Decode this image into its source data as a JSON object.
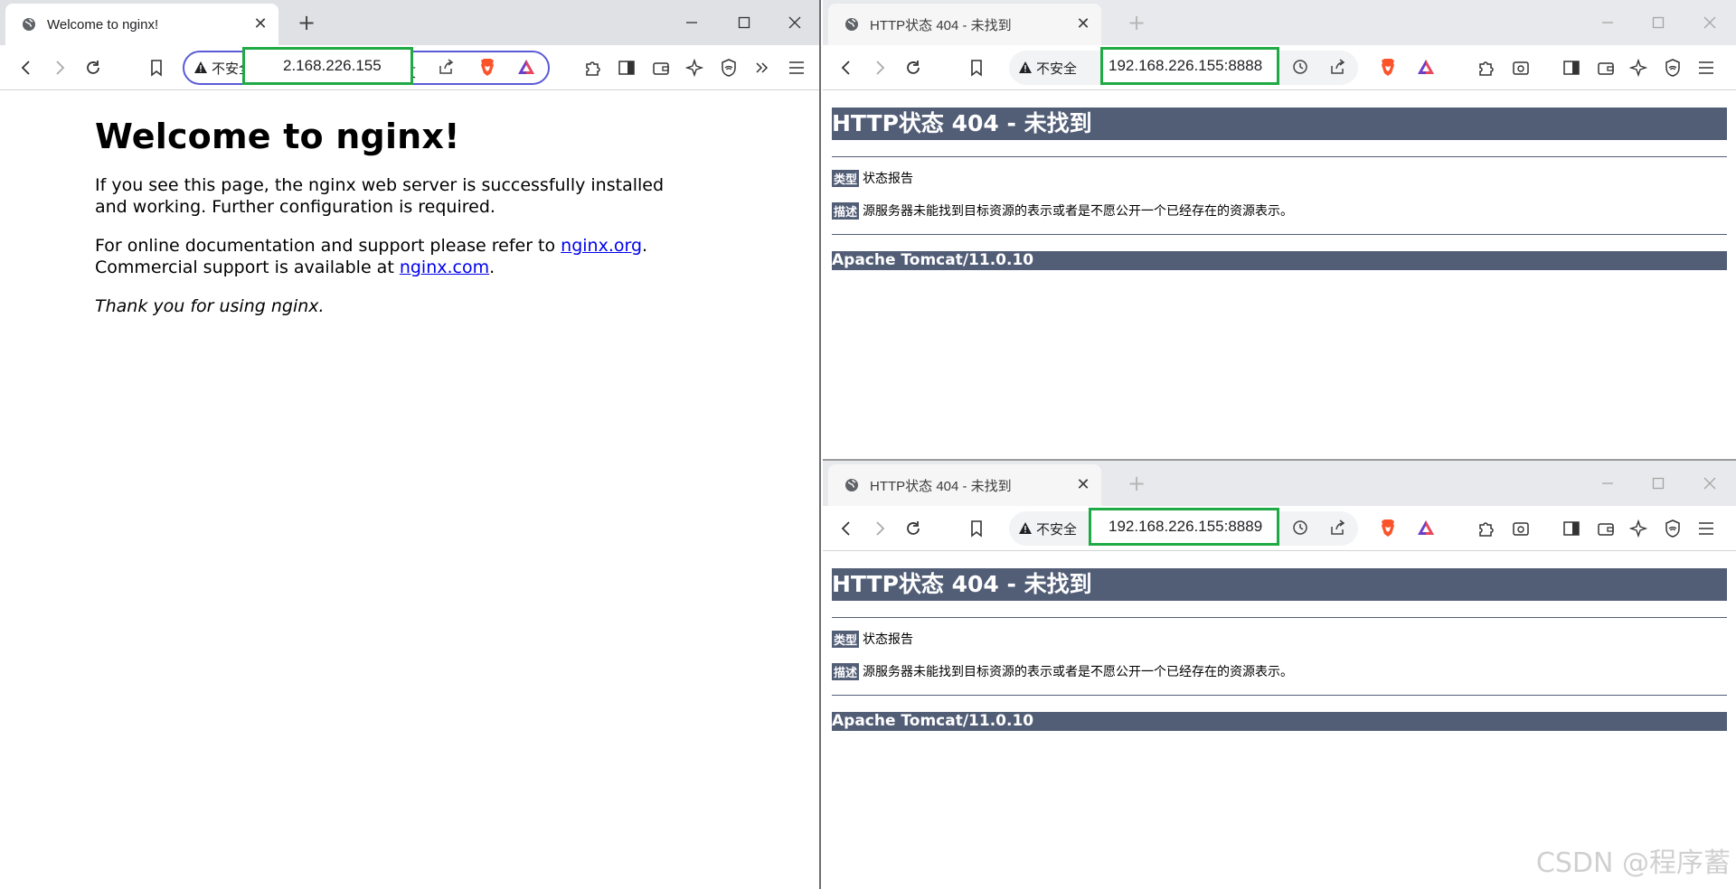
{
  "left_window": {
    "tab_title": "Welcome to nginx!",
    "tab_close": "✕",
    "new_tab": "+",
    "insecure_label": "不安全",
    "url": "2.168.226.155",
    "translate_glyph": "文",
    "page": {
      "heading": "Welcome to nginx!",
      "para1": "If you see this page, the nginx web server is successfully installed and working. Further configuration is required.",
      "para2_prefix": "For online documentation and support please refer to ",
      "link_org": "nginx.org",
      "para2_mid": ".",
      "para2_line2_prefix": "Commercial support is available at ",
      "link_com": "nginx.com",
      "para2_end": ".",
      "thanks": "Thank you for using nginx."
    }
  },
  "top_right_window": {
    "tab_title": "HTTP状态 404 - 未找到",
    "tab_close": "✕",
    "new_tab": "+",
    "insecure_label": "不安全",
    "url": "192.168.226.155:8888",
    "page": {
      "heading": "HTTP状态 404 - 未找到",
      "type_label": "类型",
      "type_value": "状态报告",
      "desc_label": "描述",
      "desc_value": "源服务器未能找到目标资源的表示或者是不愿公开一个已经存在的资源表示。",
      "footer": "Apache Tomcat/11.0.10"
    }
  },
  "bottom_right_window": {
    "tab_title": "HTTP状态 404 - 未找到",
    "tab_close": "✕",
    "new_tab": "+",
    "insecure_label": "不安全",
    "url": "192.168.226.155:8889",
    "page": {
      "heading": "HTTP状态 404 - 未找到",
      "type_label": "类型",
      "type_value": "状态报告",
      "desc_label": "描述",
      "desc_value": "源服务器未能找到目标资源的表示或者是不愿公开一个已经存在的资源表示。",
      "footer": "Apache Tomcat/11.0.10"
    }
  },
  "watermark": "CSDN @程序蓄",
  "colors": {
    "tomcat_header": "#525d76",
    "url_highlight": "#1faa45",
    "omnibox_focus": "#5a5ad8",
    "link": "#0000ee",
    "brave_orange": "#fb542b"
  }
}
